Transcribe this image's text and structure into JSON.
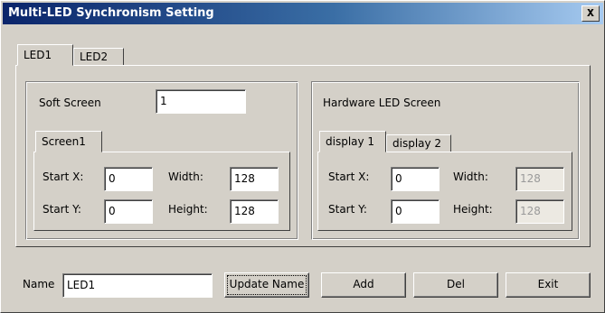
{
  "window": {
    "title": "Multi-LED Synchronism Setting",
    "close_glyph": "x"
  },
  "main_tabs": [
    {
      "label": "LED1",
      "active": true
    },
    {
      "label": "LED2",
      "active": false
    }
  ],
  "soft": {
    "label": "Soft Screen",
    "value": "1",
    "tab": "Screen1",
    "start_x_label": "Start X:",
    "start_x_value": "0",
    "start_y_label": "Start Y:",
    "start_y_value": "0",
    "width_label": "Width:",
    "width_value": "128",
    "height_label": "Height:",
    "height_value": "128"
  },
  "hardware": {
    "label": "Hardware LED Screen",
    "tabs": [
      {
        "label": "display 1",
        "active": true
      },
      {
        "label": "display 2",
        "active": false
      }
    ],
    "start_x_label": "Start X:",
    "start_x_value": "0",
    "start_y_label": "Start Y:",
    "start_y_value": "0",
    "width_label": "Width:",
    "width_value": "128",
    "height_label": "Height:",
    "height_value": "128"
  },
  "footer": {
    "name_label": "Name",
    "name_value": "LED1",
    "update_label": "Update Name",
    "add_label": "Add",
    "del_label": "Del",
    "exit_label": "Exit"
  }
}
